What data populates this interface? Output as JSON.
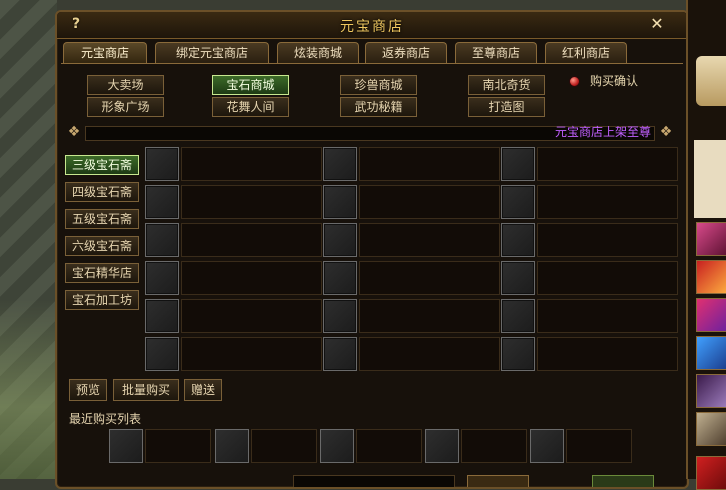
{
  "window": {
    "title": "元宝商店",
    "help_icon": "?",
    "close_icon": "✕"
  },
  "tabs": [
    {
      "label": "元宝商店",
      "active": true
    },
    {
      "label": "绑定元宝商店",
      "active": false
    },
    {
      "label": "炫装商城",
      "active": false
    },
    {
      "label": "返券商店",
      "active": false
    },
    {
      "label": "至尊商店",
      "active": false
    },
    {
      "label": "红利商店",
      "active": false
    }
  ],
  "categories": {
    "row1": [
      "大卖场",
      "宝石商城",
      "珍兽商城",
      "南北奇货"
    ],
    "row2": [
      "形象广场",
      "花舞人间",
      "武功秘籍",
      "打造图"
    ],
    "selected": "宝石商城"
  },
  "buy_confirm": {
    "label": "购买确认",
    "checked": true
  },
  "marquee": {
    "text": "元宝商店上架至尊"
  },
  "sub_categories": [
    {
      "label": "三级宝石斋",
      "selected": true
    },
    {
      "label": "四级宝石斋",
      "selected": false
    },
    {
      "label": "五级宝石斋",
      "selected": false
    },
    {
      "label": "六级宝石斋",
      "selected": false
    },
    {
      "label": "宝石精华店",
      "selected": false
    },
    {
      "label": "宝石加工坊",
      "selected": false
    }
  ],
  "actions": {
    "preview": "预览",
    "bulk_buy": "批量购买",
    "gift": "赠送"
  },
  "recent": {
    "title": "最近购买列表"
  },
  "colors": {
    "accent_gold": "#f0c860",
    "selected_green": "#3c6a28",
    "marquee_purple": "#c060ff"
  },
  "icons": [
    "help-icon",
    "close-icon",
    "radio-icon",
    "knot-icon"
  ]
}
